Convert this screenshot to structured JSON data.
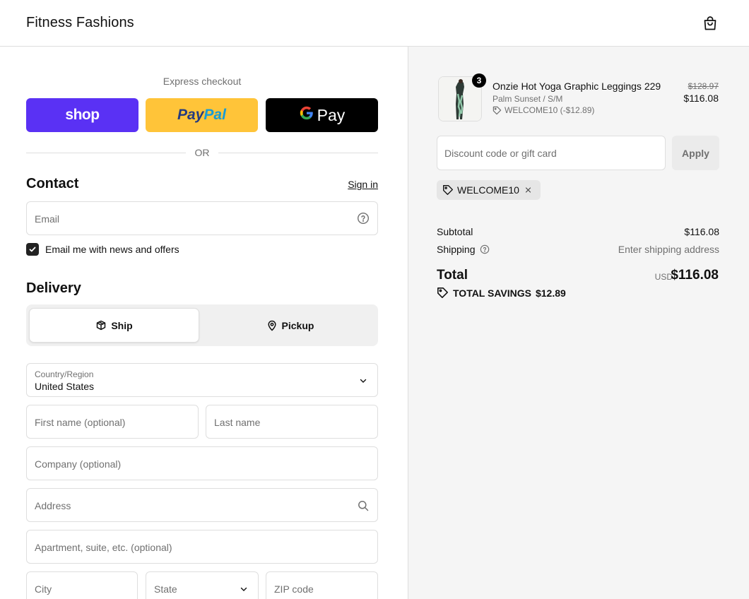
{
  "header": {
    "shop_name": "Fitness Fashions",
    "cart_icon": "shopping-bag-icon"
  },
  "express": {
    "label": "Express checkout",
    "shop_pay": "shop",
    "paypal_a": "Pay",
    "paypal_b": "Pal",
    "gpay_g": "G",
    "gpay_text": "Pay",
    "or": "OR"
  },
  "contact": {
    "title": "Contact",
    "sign_in": "Sign in",
    "email_placeholder": "Email",
    "newsletter_label": "Email me with news and offers",
    "newsletter_checked": true
  },
  "delivery": {
    "title": "Delivery",
    "ship_label": "Ship",
    "pickup_label": "Pickup",
    "country_label": "Country/Region",
    "country_value": "United States",
    "first_name": "First name (optional)",
    "last_name": "Last name",
    "company": "Company (optional)",
    "address": "Address",
    "apartment": "Apartment, suite, etc. (optional)",
    "city": "City",
    "state": "State",
    "zip": "ZIP code"
  },
  "order": {
    "quantity": "3",
    "product_name": "Onzie Hot Yoga Graphic Leggings 229",
    "variant": "Palm Sunset / S/M",
    "discount_line": "WELCOME10 (-$12.89)",
    "price_original": "$128.97",
    "price_now": "$116.08",
    "discount_placeholder": "Discount code or gift card",
    "apply_label": "Apply",
    "applied_code": "WELCOME10",
    "subtotal_label": "Subtotal",
    "subtotal_value": "$116.08",
    "shipping_label": "Shipping",
    "shipping_value": "Enter shipping address",
    "total_label": "Total",
    "currency": "USD",
    "total_value": "$116.08",
    "savings_label": "TOTAL SAVINGS",
    "savings_value": "$12.89"
  },
  "colors": {
    "shop_pay": "#5a31f4",
    "paypal": "#ffc439",
    "gpay": "#000000",
    "summary_bg": "#f5f5f5"
  }
}
